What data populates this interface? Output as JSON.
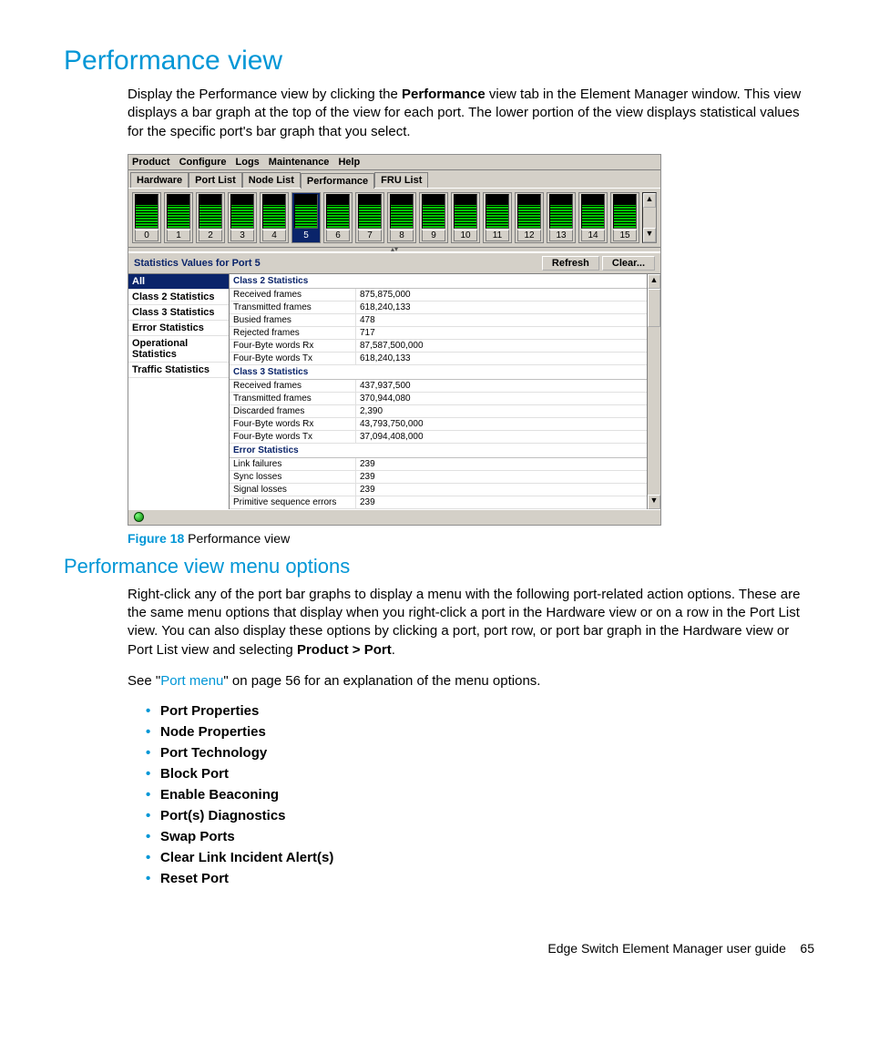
{
  "heading": "Performance view",
  "intro_parts": {
    "pre": "Display the Performance view by clicking the ",
    "bold": "Performance",
    "post": " view tab in the Element Manager window. This view displays a bar graph at the top of the view for each port. The lower portion of the view displays statistical values for the specific port's bar graph that you select."
  },
  "screenshot": {
    "menubar": [
      "Product",
      "Configure",
      "Logs",
      "Maintenance",
      "Help"
    ],
    "tabs": [
      "Hardware",
      "Port List",
      "Node List",
      "Performance",
      "FRU List"
    ],
    "active_tab_index": 3,
    "ports": [
      0,
      1,
      2,
      3,
      4,
      5,
      6,
      7,
      8,
      9,
      10,
      11,
      12,
      13,
      14,
      15
    ],
    "selected_port": 5,
    "stats_title": "Statistics Values for Port 5",
    "buttons": {
      "refresh": "Refresh",
      "clear": "Clear..."
    },
    "categories": [
      "All",
      "Class 2 Statistics",
      "Class 3 Statistics",
      "Error Statistics",
      "Operational Statistics",
      "Traffic Statistics"
    ],
    "selected_category_index": 0,
    "groups": [
      {
        "name": "Class 2 Statistics",
        "rows": [
          {
            "k": "Received frames",
            "v": "875,875,000"
          },
          {
            "k": "Transmitted frames",
            "v": "618,240,133"
          },
          {
            "k": "Busied frames",
            "v": "478"
          },
          {
            "k": "Rejected frames",
            "v": "717"
          },
          {
            "k": "Four-Byte words Rx",
            "v": "87,587,500,000"
          },
          {
            "k": "Four-Byte words Tx",
            "v": "618,240,133"
          }
        ]
      },
      {
        "name": "Class 3 Statistics",
        "rows": [
          {
            "k": "Received frames",
            "v": "437,937,500"
          },
          {
            "k": "Transmitted frames",
            "v": "370,944,080"
          },
          {
            "k": "Discarded frames",
            "v": "2,390"
          },
          {
            "k": "Four-Byte words Rx",
            "v": "43,793,750,000"
          },
          {
            "k": "Four-Byte words Tx",
            "v": "37,094,408,000"
          }
        ]
      },
      {
        "name": "Error Statistics",
        "rows": [
          {
            "k": "Link failures",
            "v": "239"
          },
          {
            "k": "Sync losses",
            "v": "239"
          },
          {
            "k": "Signal losses",
            "v": "239"
          },
          {
            "k": "Primitive sequence errors",
            "v": "239"
          }
        ]
      }
    ]
  },
  "figure": {
    "label": "Figure 18",
    "caption": "Performance view"
  },
  "subheading": "Performance view menu options",
  "para2_parts": {
    "p1": "Right-click any of the port bar graphs to display a menu with the following port-related action options. These are the same menu options that display when you right-click a port in the Hardware view or on a row in the Port List view. You can also display these options by clicking a port, port row, or port bar graph in the Hardware view or Port List view and selecting ",
    "bold": "Product > Port",
    "p2": "."
  },
  "see_parts": {
    "pre": "See \"",
    "link": "Port menu",
    "post": "\" on page 56 for an explanation of the menu options."
  },
  "menu_items": [
    "Port Properties",
    "Node Properties",
    "Port Technology",
    "Block Port",
    "Enable Beaconing",
    "Port(s) Diagnostics",
    "Swap Ports",
    "Clear Link Incident Alert(s)",
    "Reset Port"
  ],
  "footer": {
    "title": "Edge Switch Element Manager user guide",
    "page": "65"
  }
}
